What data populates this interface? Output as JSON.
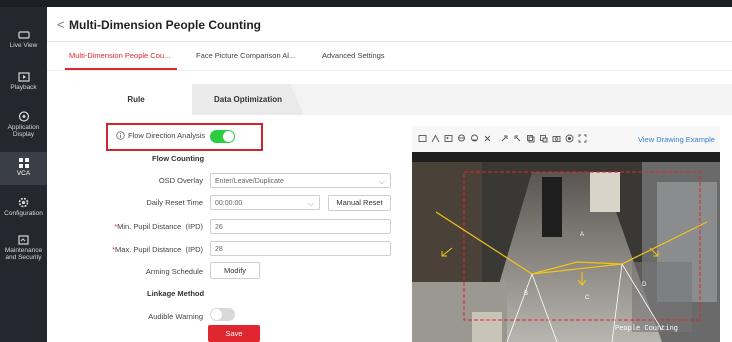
{
  "sidebar": {
    "items": [
      {
        "label": "Live View",
        "icon": "monitor-icon"
      },
      {
        "label": "Playback",
        "icon": "playback-icon"
      },
      {
        "label": "Application Display",
        "icon": "application-icon"
      },
      {
        "label": "VCA",
        "icon": "vca-grid-icon"
      },
      {
        "label": "Configuration",
        "icon": "gear-icon"
      },
      {
        "label": "Maintenance and Security",
        "icon": "maintenance-icon"
      }
    ]
  },
  "header": {
    "back": "<",
    "title": "Multi-Dimension People Counting"
  },
  "tabs": [
    {
      "label": "Multi-Dimension People Cou..."
    },
    {
      "label": "Face Picture Comparison Al..."
    },
    {
      "label": "Advanced Settings"
    }
  ],
  "subtabs": [
    {
      "label": "Rule"
    },
    {
      "label": "Data Optimization"
    }
  ],
  "form": {
    "flow_direction": {
      "label": "Flow Direction Analysis",
      "enabled": true
    },
    "flow_counting_title": "Flow Counting",
    "osd_overlay": {
      "label": "OSD Overlay",
      "value": "Enter/Leave/Duplicate"
    },
    "daily_reset": {
      "label": "Daily Reset Time",
      "value": "00:00:00",
      "button": "Manual Reset"
    },
    "min_ipd": {
      "required": "*",
      "label": "Min. Pupil Distance  (IPD)",
      "value": "26"
    },
    "max_ipd": {
      "required": "*",
      "label": "Max. Pupil Distance  (IPD)",
      "value": "28"
    },
    "arming": {
      "label": "Arming Schedule",
      "button": "Modify"
    },
    "linkage_title": "Linkage Method",
    "audible": {
      "label": "Audible Warning",
      "enabled": false
    },
    "save": "Save"
  },
  "video": {
    "link": "View Drawing Example",
    "osd_text": "People Counting",
    "region_labels": [
      "A",
      "B",
      "C",
      "D"
    ]
  },
  "colors": {
    "accent": "#d9282f",
    "toggle_on": "#2ecc40",
    "link": "#3d7fd3",
    "region_line": "#f0c419",
    "region_box": "#e0262e"
  }
}
